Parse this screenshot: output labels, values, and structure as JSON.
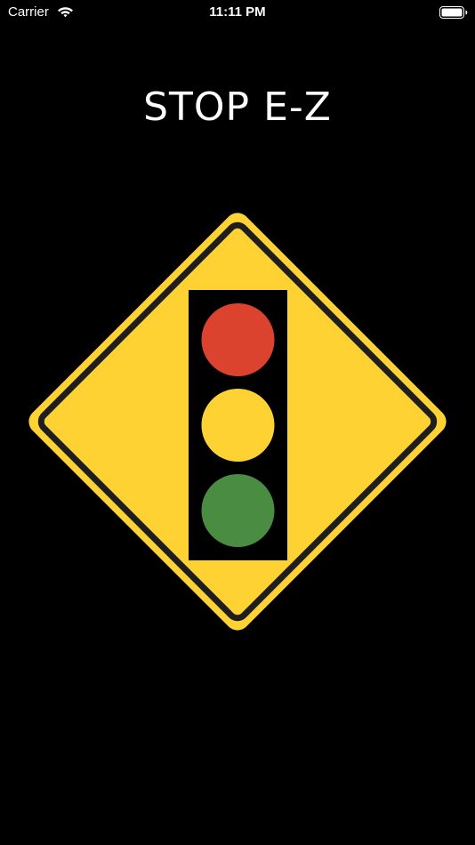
{
  "status_bar": {
    "carrier": "Carrier",
    "time": "11:11 PM",
    "wifi_icon": "wifi-icon",
    "battery_icon": "battery-icon"
  },
  "app": {
    "title": "STOP E-Z"
  },
  "sign": {
    "icon": "traffic-signal-ahead-sign",
    "colors": {
      "sign_fill": "#FFD234",
      "sign_border": "#1E1E1E",
      "housing": "#000000",
      "red_light": "#DC432E",
      "yellow_light": "#FFD234",
      "green_light": "#4A8C41"
    }
  }
}
